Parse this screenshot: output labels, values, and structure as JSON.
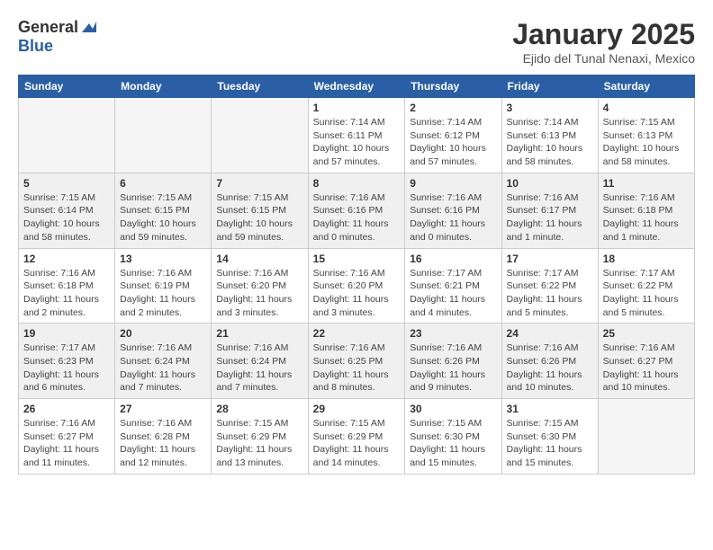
{
  "header": {
    "logo_general": "General",
    "logo_blue": "Blue",
    "month_title": "January 2025",
    "location": "Ejido del Tunal Nenaxi, Mexico"
  },
  "weekdays": [
    "Sunday",
    "Monday",
    "Tuesday",
    "Wednesday",
    "Thursday",
    "Friday",
    "Saturday"
  ],
  "weeks": [
    {
      "shaded": false,
      "days": [
        {
          "num": "",
          "info": ""
        },
        {
          "num": "",
          "info": ""
        },
        {
          "num": "",
          "info": ""
        },
        {
          "num": "1",
          "info": "Sunrise: 7:14 AM\nSunset: 6:11 PM\nDaylight: 10 hours\nand 57 minutes."
        },
        {
          "num": "2",
          "info": "Sunrise: 7:14 AM\nSunset: 6:12 PM\nDaylight: 10 hours\nand 57 minutes."
        },
        {
          "num": "3",
          "info": "Sunrise: 7:14 AM\nSunset: 6:13 PM\nDaylight: 10 hours\nand 58 minutes."
        },
        {
          "num": "4",
          "info": "Sunrise: 7:15 AM\nSunset: 6:13 PM\nDaylight: 10 hours\nand 58 minutes."
        }
      ]
    },
    {
      "shaded": true,
      "days": [
        {
          "num": "5",
          "info": "Sunrise: 7:15 AM\nSunset: 6:14 PM\nDaylight: 10 hours\nand 58 minutes."
        },
        {
          "num": "6",
          "info": "Sunrise: 7:15 AM\nSunset: 6:15 PM\nDaylight: 10 hours\nand 59 minutes."
        },
        {
          "num": "7",
          "info": "Sunrise: 7:15 AM\nSunset: 6:15 PM\nDaylight: 10 hours\nand 59 minutes."
        },
        {
          "num": "8",
          "info": "Sunrise: 7:16 AM\nSunset: 6:16 PM\nDaylight: 11 hours\nand 0 minutes."
        },
        {
          "num": "9",
          "info": "Sunrise: 7:16 AM\nSunset: 6:16 PM\nDaylight: 11 hours\nand 0 minutes."
        },
        {
          "num": "10",
          "info": "Sunrise: 7:16 AM\nSunset: 6:17 PM\nDaylight: 11 hours\nand 1 minute."
        },
        {
          "num": "11",
          "info": "Sunrise: 7:16 AM\nSunset: 6:18 PM\nDaylight: 11 hours\nand 1 minute."
        }
      ]
    },
    {
      "shaded": false,
      "days": [
        {
          "num": "12",
          "info": "Sunrise: 7:16 AM\nSunset: 6:18 PM\nDaylight: 11 hours\nand 2 minutes."
        },
        {
          "num": "13",
          "info": "Sunrise: 7:16 AM\nSunset: 6:19 PM\nDaylight: 11 hours\nand 2 minutes."
        },
        {
          "num": "14",
          "info": "Sunrise: 7:16 AM\nSunset: 6:20 PM\nDaylight: 11 hours\nand 3 minutes."
        },
        {
          "num": "15",
          "info": "Sunrise: 7:16 AM\nSunset: 6:20 PM\nDaylight: 11 hours\nand 3 minutes."
        },
        {
          "num": "16",
          "info": "Sunrise: 7:17 AM\nSunset: 6:21 PM\nDaylight: 11 hours\nand 4 minutes."
        },
        {
          "num": "17",
          "info": "Sunrise: 7:17 AM\nSunset: 6:22 PM\nDaylight: 11 hours\nand 5 minutes."
        },
        {
          "num": "18",
          "info": "Sunrise: 7:17 AM\nSunset: 6:22 PM\nDaylight: 11 hours\nand 5 minutes."
        }
      ]
    },
    {
      "shaded": true,
      "days": [
        {
          "num": "19",
          "info": "Sunrise: 7:17 AM\nSunset: 6:23 PM\nDaylight: 11 hours\nand 6 minutes."
        },
        {
          "num": "20",
          "info": "Sunrise: 7:16 AM\nSunset: 6:24 PM\nDaylight: 11 hours\nand 7 minutes."
        },
        {
          "num": "21",
          "info": "Sunrise: 7:16 AM\nSunset: 6:24 PM\nDaylight: 11 hours\nand 7 minutes."
        },
        {
          "num": "22",
          "info": "Sunrise: 7:16 AM\nSunset: 6:25 PM\nDaylight: 11 hours\nand 8 minutes."
        },
        {
          "num": "23",
          "info": "Sunrise: 7:16 AM\nSunset: 6:26 PM\nDaylight: 11 hours\nand 9 minutes."
        },
        {
          "num": "24",
          "info": "Sunrise: 7:16 AM\nSunset: 6:26 PM\nDaylight: 11 hours\nand 10 minutes."
        },
        {
          "num": "25",
          "info": "Sunrise: 7:16 AM\nSunset: 6:27 PM\nDaylight: 11 hours\nand 10 minutes."
        }
      ]
    },
    {
      "shaded": false,
      "days": [
        {
          "num": "26",
          "info": "Sunrise: 7:16 AM\nSunset: 6:27 PM\nDaylight: 11 hours\nand 11 minutes."
        },
        {
          "num": "27",
          "info": "Sunrise: 7:16 AM\nSunset: 6:28 PM\nDaylight: 11 hours\nand 12 minutes."
        },
        {
          "num": "28",
          "info": "Sunrise: 7:15 AM\nSunset: 6:29 PM\nDaylight: 11 hours\nand 13 minutes."
        },
        {
          "num": "29",
          "info": "Sunrise: 7:15 AM\nSunset: 6:29 PM\nDaylight: 11 hours\nand 14 minutes."
        },
        {
          "num": "30",
          "info": "Sunrise: 7:15 AM\nSunset: 6:30 PM\nDaylight: 11 hours\nand 15 minutes."
        },
        {
          "num": "31",
          "info": "Sunrise: 7:15 AM\nSunset: 6:30 PM\nDaylight: 11 hours\nand 15 minutes."
        },
        {
          "num": "",
          "info": ""
        }
      ]
    }
  ]
}
